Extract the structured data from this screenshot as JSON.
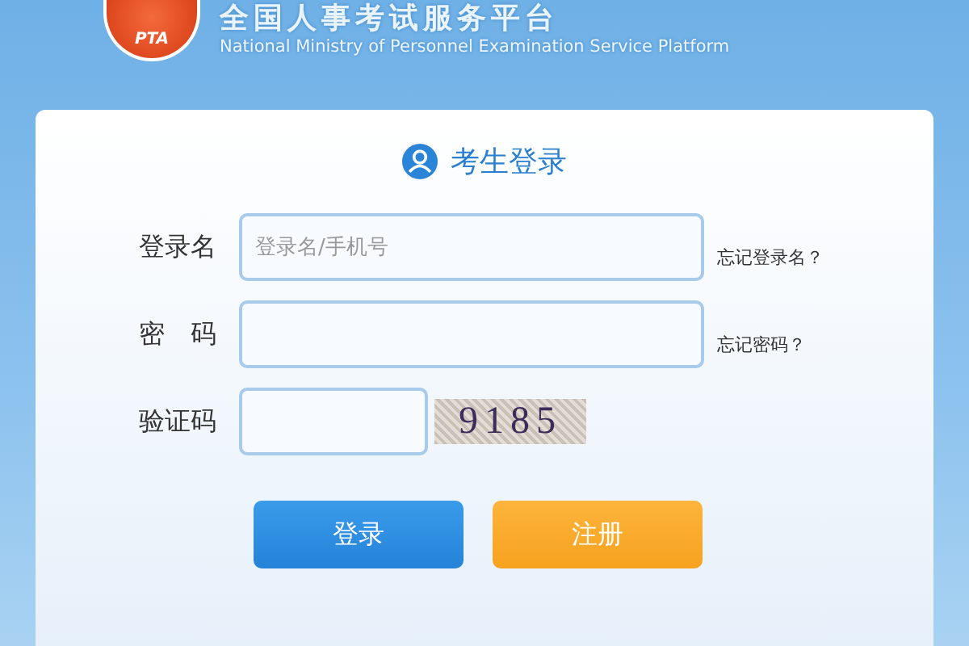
{
  "header": {
    "logo_text": "PTA",
    "title": "全国人事考试服务平台",
    "subtitle": "National Ministry of Personnel Examination Service Platform"
  },
  "login": {
    "heading": "考生登录",
    "fields": [
      {
        "kind": "text",
        "label": "登录名",
        "placeholder": "登录名/手机号",
        "link": "忘记登录名？"
      },
      {
        "kind": "password",
        "label": "密　码",
        "link": "忘记密码？"
      },
      {
        "kind": "captcha",
        "label": "验证码",
        "captcha": "9185"
      }
    ],
    "buttons": [
      {
        "kind": "primary",
        "label": "登录"
      },
      {
        "kind": "secondary",
        "label": "注册"
      }
    ]
  }
}
